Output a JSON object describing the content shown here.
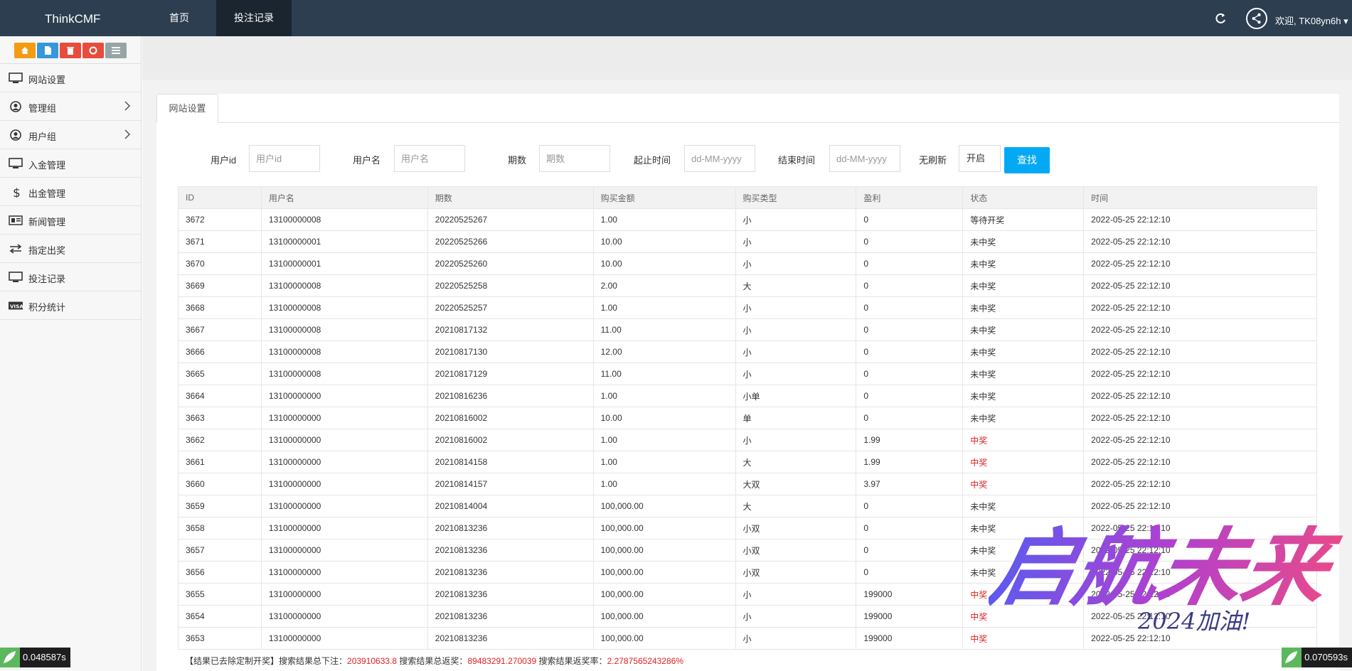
{
  "navbar": {
    "brand": "ThinkCMF",
    "items": [
      {
        "label": "首页",
        "active": false
      },
      {
        "label": "投注记录",
        "active": true
      }
    ],
    "welcome": "欢迎, TK08yn6h ▾"
  },
  "sidebar": {
    "shortcut_colors": [
      "#f39c12",
      "#3498db",
      "#e74c3c",
      "#e74c3c",
      "#95a5a6"
    ],
    "items": [
      {
        "label": "网站设置",
        "icon": "monitor-icon"
      },
      {
        "label": "管理组",
        "icon": "user-circle-icon",
        "expandable": true
      },
      {
        "label": "用户组",
        "icon": "user-circle-icon",
        "expandable": true
      },
      {
        "label": "入金管理",
        "icon": "monitor-icon"
      },
      {
        "label": "出金管理",
        "icon": "dollar-icon"
      },
      {
        "label": "新闻管理",
        "icon": "newspaper-icon"
      },
      {
        "label": "指定出奖",
        "icon": "exchange-icon"
      },
      {
        "label": "投注记录",
        "icon": "monitor-icon"
      },
      {
        "label": "积分统计",
        "icon": "visa-icon"
      }
    ]
  },
  "tab": {
    "label": "网站设置"
  },
  "filters": {
    "user_id": {
      "label": "用户id",
      "placeholder": "用户id"
    },
    "username": {
      "label": "用户名",
      "placeholder": "用户名"
    },
    "period": {
      "label": "期数",
      "placeholder": "期数"
    },
    "start_time": {
      "label": "起止时间",
      "placeholder": "dd-MM-yyyy"
    },
    "end_time": {
      "label": "结束时间",
      "placeholder": "dd-MM-yyyy"
    },
    "no_refresh": {
      "label": "无刷新",
      "value": "开启"
    },
    "search_button": "查找"
  },
  "table": {
    "headers": [
      "ID",
      "用户名",
      "期数",
      "购买金额",
      "购买类型",
      "盈利",
      "状态",
      "时间"
    ],
    "rows": [
      [
        "3672",
        "13100000008",
        "20220525267",
        "1.00",
        "小",
        "0",
        "等待开奖",
        "2022-05-25 22:12:10"
      ],
      [
        "3671",
        "13100000001",
        "20220525266",
        "10.00",
        "小",
        "0",
        "未中奖",
        "2022-05-25 22:12:10"
      ],
      [
        "3670",
        "13100000001",
        "20220525260",
        "10.00",
        "小",
        "0",
        "未中奖",
        "2022-05-25 22:12:10"
      ],
      [
        "3669",
        "13100000008",
        "20220525258",
        "2.00",
        "大",
        "0",
        "未中奖",
        "2022-05-25 22:12:10"
      ],
      [
        "3668",
        "13100000008",
        "20220525257",
        "1.00",
        "小",
        "0",
        "未中奖",
        "2022-05-25 22:12:10"
      ],
      [
        "3667",
        "13100000008",
        "20210817132",
        "11.00",
        "小",
        "0",
        "未中奖",
        "2022-05-25 22:12:10"
      ],
      [
        "3666",
        "13100000008",
        "20210817130",
        "12.00",
        "小",
        "0",
        "未中奖",
        "2022-05-25 22:12:10"
      ],
      [
        "3665",
        "13100000008",
        "20210817129",
        "11.00",
        "小",
        "0",
        "未中奖",
        "2022-05-25 22:12:10"
      ],
      [
        "3664",
        "13100000000",
        "20210816236",
        "1.00",
        "小单",
        "0",
        "未中奖",
        "2022-05-25 22:12:10"
      ],
      [
        "3663",
        "13100000000",
        "20210816002",
        "10.00",
        "单",
        "0",
        "未中奖",
        "2022-05-25 22:12:10"
      ],
      [
        "3662",
        "13100000000",
        "20210816002",
        "1.00",
        "小",
        "1.99",
        "中奖",
        "2022-05-25 22:12:10"
      ],
      [
        "3661",
        "13100000000",
        "20210814158",
        "1.00",
        "大",
        "1.99",
        "中奖",
        "2022-05-25 22:12:10"
      ],
      [
        "3660",
        "13100000000",
        "20210814157",
        "1.00",
        "大双",
        "3.97",
        "中奖",
        "2022-05-25 22:12:10"
      ],
      [
        "3659",
        "13100000000",
        "20210814004",
        "100,000.00",
        "大",
        "0",
        "未中奖",
        "2022-05-25 22:12:10"
      ],
      [
        "3658",
        "13100000000",
        "20210813236",
        "100,000.00",
        "小双",
        "0",
        "未中奖",
        "2022-05-25 22:12:10"
      ],
      [
        "3657",
        "13100000000",
        "20210813236",
        "100,000.00",
        "小双",
        "0",
        "未中奖",
        "2022-05-25 22:12:10"
      ],
      [
        "3656",
        "13100000000",
        "20210813236",
        "100,000.00",
        "小双",
        "0",
        "未中奖",
        "2022-05-25 22:12:10"
      ],
      [
        "3655",
        "13100000000",
        "20210813236",
        "100,000.00",
        "小",
        "199000",
        "中奖",
        "2022-05-25 22:12:10"
      ],
      [
        "3654",
        "13100000000",
        "20210813236",
        "100,000.00",
        "小",
        "199000",
        "中奖",
        "2022-05-25 22:12:10"
      ],
      [
        "3653",
        "13100000000",
        "20210813236",
        "100,000.00",
        "小",
        "199000",
        "中奖",
        "2022-05-25 22:12:10"
      ]
    ]
  },
  "summary": {
    "prefix": "【结果已去除定制开奖】搜索结果总下注：",
    "total_bet": "203910633.8",
    "return_label": " 搜索结果总返奖：",
    "total_return": "89483291.270039",
    "rate_label": " 搜索结果返奖率：",
    "return_rate": "2.2787565243286%"
  },
  "timers": {
    "left": "0.048587s",
    "right": "0.070593s"
  },
  "watermark": {
    "main": "启航未来",
    "sub": "2024加油!"
  },
  "colors": {
    "navbar": "#2c3e50",
    "accent": "#03a9f4",
    "win": "#e02020"
  }
}
